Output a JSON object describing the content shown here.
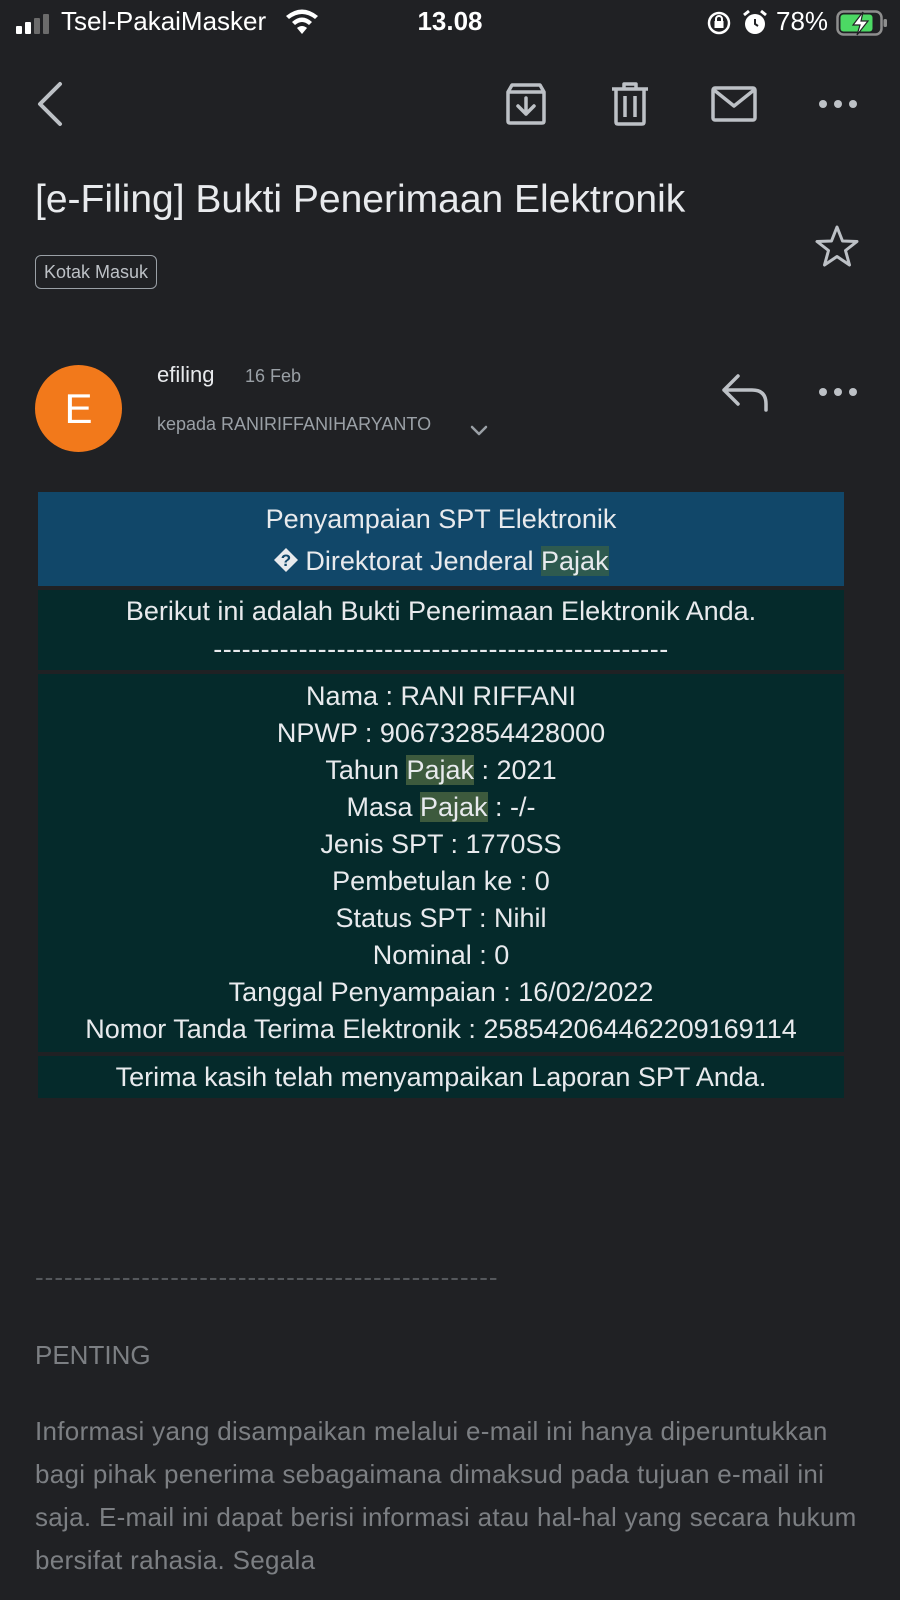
{
  "status_bar": {
    "carrier": "Tsel-PakaiMasker",
    "time": "13.08",
    "battery": "78%"
  },
  "toolbar": {
    "icons": [
      "back-icon",
      "archive-icon",
      "trash-icon",
      "mail-icon",
      "more-icon"
    ]
  },
  "email": {
    "subject": "[e-Filing] Bukti Penerimaan Elektronik",
    "label": "Kotak Masuk",
    "avatar_letter": "E",
    "sender": "efiling",
    "date": "16 Feb",
    "recipient": "kepada RANIRIFFANIHARYANTO"
  },
  "body": {
    "header_line1": "Penyampaian SPT Elektronik",
    "header_line2_pre": "Direktorat Jenderal ",
    "header_line2_hl": "Pajak",
    "intro": "Berikut ini adalah Bukti Penerimaan Elektronik Anda.",
    "intro_divider": "------------------------------------------------",
    "fields": {
      "nama": "Nama : RANI RIFFANI",
      "npwp": "NPWP : 906732854428000",
      "tahun_pre": "Tahun ",
      "tahun_hl": "Pajak",
      "tahun_post": " : 2021",
      "masa_pre": "Masa ",
      "masa_hl": "Pajak",
      "masa_post": " : -/-",
      "jenis": "Jenis SPT : 1770SS",
      "pembetulan": "Pembetulan ke : 0",
      "status": "Status SPT : Nihil",
      "nominal": "Nominal : 0",
      "tanggal": "Tanggal Penyampaian : 16/02/2022",
      "nomor": "Nomor Tanda Terima Elektronik : 25854206446220916911​4"
    },
    "thanks": "Terima kasih telah menyampaikan Laporan SPT Anda."
  },
  "footer": {
    "divider": "------------------------------------------------",
    "heading": "PENTING",
    "paragraph": "Informasi yang disampaikan melalui e-mail ini hanya diperuntukkan bagi pihak penerima sebagaimana dimaksud pada tujuan e-mail ini saja. E-mail ini dapat berisi informasi atau hal-hal yang secara hukum bersifat rahasia. Segala"
  }
}
